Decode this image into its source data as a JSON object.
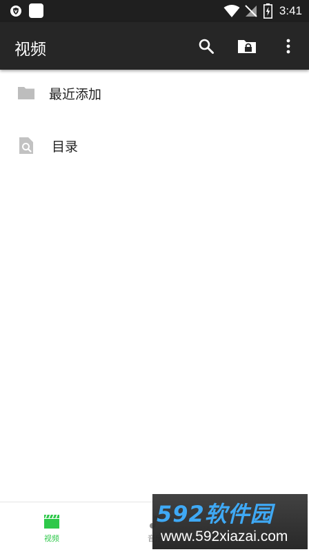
{
  "status_bar": {
    "time": "3:41",
    "icons": [
      "shield-notification-icon",
      "app-notification-icon",
      "wifi-icon",
      "no-signal-icon",
      "battery-charging-icon"
    ]
  },
  "app_bar": {
    "title": "视频",
    "actions": [
      "search-icon",
      "lock-folder-icon",
      "more-vert-icon"
    ]
  },
  "list": {
    "items": [
      {
        "label": "最近添加",
        "icon": "folder-icon"
      },
      {
        "label": "目录",
        "icon": "file-search-icon"
      }
    ]
  },
  "bottom_nav": {
    "items": [
      {
        "label": "视频",
        "icon": "video-clapper-icon",
        "active": true
      },
      {
        "label": "音乐",
        "icon": "music-note-icon",
        "active": false
      }
    ],
    "active_color": "#2ec84a",
    "inactive_color": "#8a8a8a"
  },
  "watermark": {
    "brand": "592软件园",
    "url": "www.592xiazai.com"
  },
  "colors": {
    "app_bar": "#262626",
    "status_bar": "#1f1f1f",
    "accent": "#2ec84a"
  }
}
